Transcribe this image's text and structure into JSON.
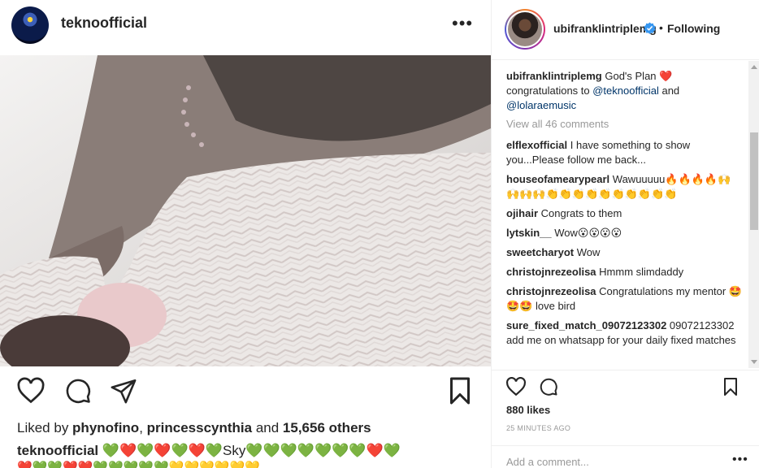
{
  "left_post": {
    "username": "teknoofficial",
    "more_label": "•••",
    "likes_prefix": "Liked by ",
    "liker1": "phynofino",
    "sep": ", ",
    "liker2": "princesscynthia",
    "and": " and ",
    "others": "15,656 others",
    "caption_user": "teknoofficial",
    "caption_text": " 💚❤️💚❤️💚❤️💚Sky💚💚💚💚💚💚💚❤️💚",
    "caption_line2": "❤️💚💚❤️❤️💚💚💚💚💚💛💛💛💛💛💛"
  },
  "right_post": {
    "username": "ubifranklintriplemg",
    "dot": "•",
    "following": "Following",
    "caption": {
      "user": "ubifranklintriplemg",
      "text1": " God's Plan ❤️ congratulations to ",
      "mention1": "@teknoofficial",
      "text2": " and ",
      "mention2": "@lolaraemusic"
    },
    "view_all": "View all 46 comments",
    "comments": [
      {
        "user": "elflexofficial",
        "text": " I have something to show you...Please follow me back..."
      },
      {
        "user": "houseofamearypearl",
        "text": " Wawuuuuu🔥🔥🔥🔥🙌🙌🙌🙌👏👏👏👏👏👏👏👏👏👏"
      },
      {
        "user": "ojihair",
        "text": " Congrats to them"
      },
      {
        "user": "lytskin__",
        "text": " Wow😮😮😮😮"
      },
      {
        "user": "sweetcharyot",
        "text": " Wow"
      },
      {
        "user": "christojnrezeolisa",
        "text": " Hmmm slimdaddy"
      },
      {
        "user": "christojnrezeolisa",
        "text": " Congratulations my mentor 🤩🤩🤩 love bird"
      },
      {
        "user": "sure_fixed_match_09072123302",
        "text": " 09072123302 add me on whatsapp for your daily fixed matches"
      }
    ],
    "likes": "880 likes",
    "time": "25 MINUTES AGO",
    "add_comment_placeholder": "Add a comment...",
    "more_label": "•••"
  },
  "icons": {
    "like": "heart-icon",
    "comment": "comment-icon",
    "share": "share-icon",
    "save": "bookmark-icon",
    "more": "more-icon",
    "verified": "verified-badge-icon"
  },
  "colors": {
    "text": "#262626",
    "muted": "#999999",
    "mention": "#003569",
    "verified": "#3897f0",
    "heart": "#ed4956"
  }
}
